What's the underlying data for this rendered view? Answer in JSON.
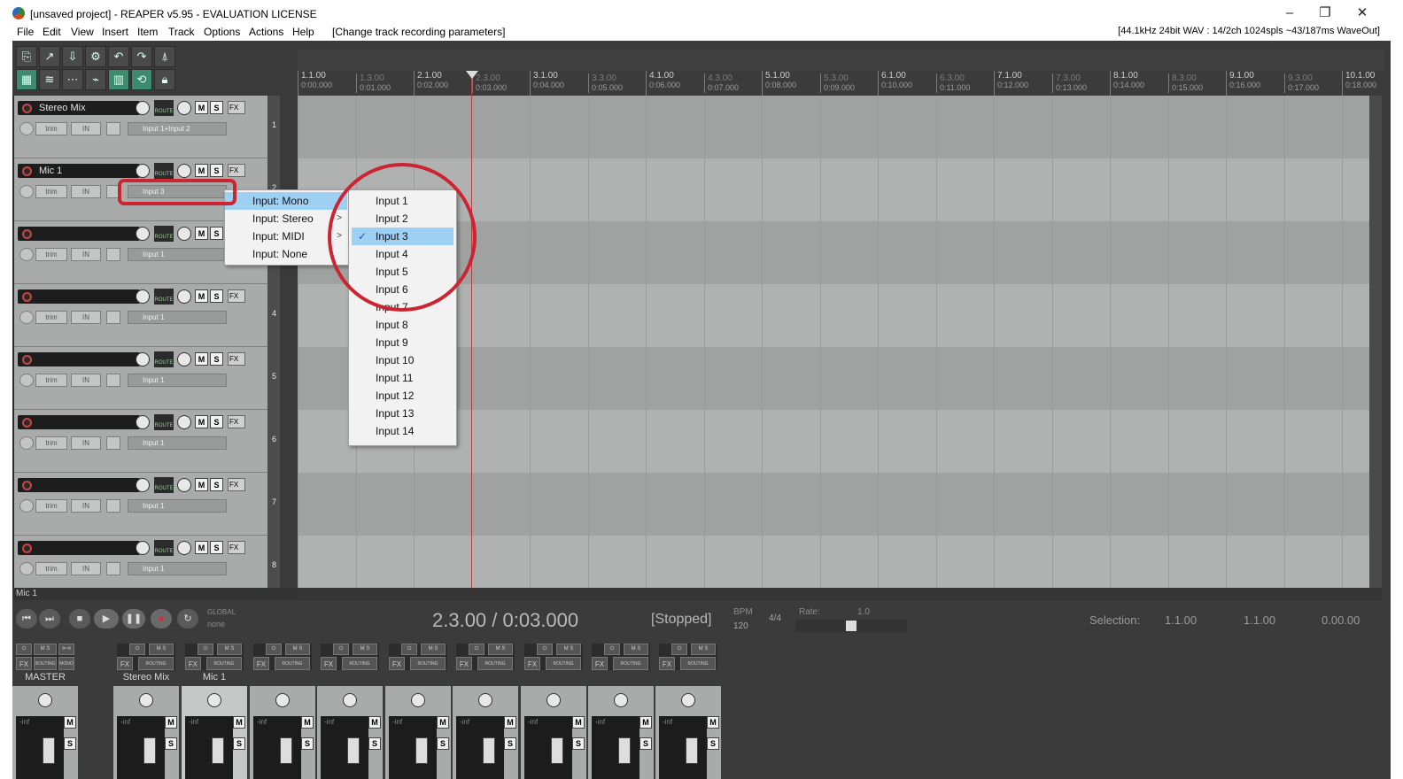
{
  "window": {
    "title": "[unsaved project] - REAPER v5.95 - EVALUATION LICENSE",
    "minimize": "–",
    "restore": "❐",
    "close": "✕"
  },
  "menubar": {
    "items": [
      "File",
      "Edit",
      "View",
      "Insert",
      "Item",
      "Track",
      "Options",
      "Actions",
      "Help",
      "[Change track recording parameters]"
    ],
    "status": "[44.1kHz 24bit WAV : 14/2ch 1024spls ~43/187ms WaveOut]"
  },
  "ruler": {
    "major": [
      {
        "bar": "1.1.00",
        "time": "0:00.000"
      },
      {
        "bar": "2.1.00",
        "time": "0:02.000"
      },
      {
        "bar": "3.1.00",
        "time": "0:04.000"
      },
      {
        "bar": "4.1.00",
        "time": "0:06.000"
      },
      {
        "bar": "5.1.00",
        "time": "0:08.000"
      },
      {
        "bar": "6.1.00",
        "time": "0:10.000"
      },
      {
        "bar": "7.1.00",
        "time": "0:12.000"
      },
      {
        "bar": "8.1.00",
        "time": "0:14.000"
      },
      {
        "bar": "9.1.00",
        "time": "0:16.000"
      },
      {
        "bar": "10.1.00",
        "time": "0:18.000"
      }
    ],
    "minor": [
      {
        "bar": "1.3.00",
        "time": "0:01.000"
      },
      {
        "bar": "2.3.00",
        "time": "0:03.000"
      },
      {
        "bar": "3.3.00",
        "time": "0:05.000"
      },
      {
        "bar": "4.3.00",
        "time": "0:07.000"
      },
      {
        "bar": "5.3.00",
        "time": "0:09.000"
      },
      {
        "bar": "6.3.00",
        "time": "0:11.000"
      },
      {
        "bar": "7.3.00",
        "time": "0:13.000"
      },
      {
        "bar": "8.3.00",
        "time": "0:15.000"
      },
      {
        "bar": "9.3.00",
        "time": "0:17.000"
      }
    ]
  },
  "tracks": [
    {
      "name": "Stereo Mix",
      "number": "1",
      "input": "Input 1+Input 2"
    },
    {
      "name": "Mic 1",
      "number": "2",
      "input": "Input 3"
    },
    {
      "name": "",
      "number": "3",
      "input": "Input 1"
    },
    {
      "name": "",
      "number": "4",
      "input": "Input 1"
    },
    {
      "name": "",
      "number": "5",
      "input": "Input 1"
    },
    {
      "name": "",
      "number": "6",
      "input": "Input 1"
    },
    {
      "name": "",
      "number": "7",
      "input": "Input 1"
    },
    {
      "name": "",
      "number": "8",
      "input": "Input 1"
    }
  ],
  "track_labels": {
    "m": "M",
    "s": "S",
    "fx": "FX",
    "trim": "trim",
    "in": "IN",
    "route": "ROUTE"
  },
  "input_menu": {
    "items": [
      {
        "label": "Input: Mono",
        "submenu": true,
        "highlighted": true
      },
      {
        "label": "Input: Stereo",
        "submenu": true
      },
      {
        "label": "Input: MIDI",
        "submenu": true
      },
      {
        "label": "Input: None",
        "submenu": false
      }
    ],
    "arrow": ">"
  },
  "mono_submenu": {
    "items": [
      "Input 1",
      "Input 2",
      "Input 3",
      "Input 4",
      "Input 5",
      "Input 6",
      "Input 7",
      "Input 8",
      "Input 9",
      "Input 10",
      "Input 11",
      "Input 12",
      "Input 13",
      "Input 14"
    ],
    "selected": "Input 3",
    "check": "✓"
  },
  "status_track": "Mic 1",
  "transport": {
    "time": "2.3.00 / 0:03.000",
    "state": "[Stopped]",
    "bpm_label": "BPM",
    "bpm": "120",
    "timesig": "4/4",
    "rate_label": "Rate:",
    "rate": "1.0",
    "global_label": "GLOBAL",
    "global_value": "none",
    "selection_label": "Selection:",
    "selection_start": "1.1.00",
    "selection_end": "1.1.00",
    "selection_length": "0.00.00"
  },
  "mixer": {
    "strips": [
      {
        "name": "MASTER",
        "selected": false
      },
      {
        "name": "Stereo Mix",
        "selected": false
      },
      {
        "name": "Mic 1",
        "selected": true
      },
      {
        "name": "",
        "selected": false
      },
      {
        "name": "",
        "selected": false
      },
      {
        "name": "",
        "selected": false
      },
      {
        "name": "",
        "selected": false
      },
      {
        "name": "",
        "selected": false
      },
      {
        "name": "",
        "selected": false
      },
      {
        "name": "",
        "selected": false
      }
    ],
    "m": "M",
    "s": "S",
    "fx": "FX",
    "routing": "ROUTING",
    "mono": "MONO",
    "inf": "-inf"
  },
  "colors": {
    "annotation": "#cc2430",
    "menu_highlight": "#9ed0f4",
    "track_bg": "#a9abab"
  }
}
